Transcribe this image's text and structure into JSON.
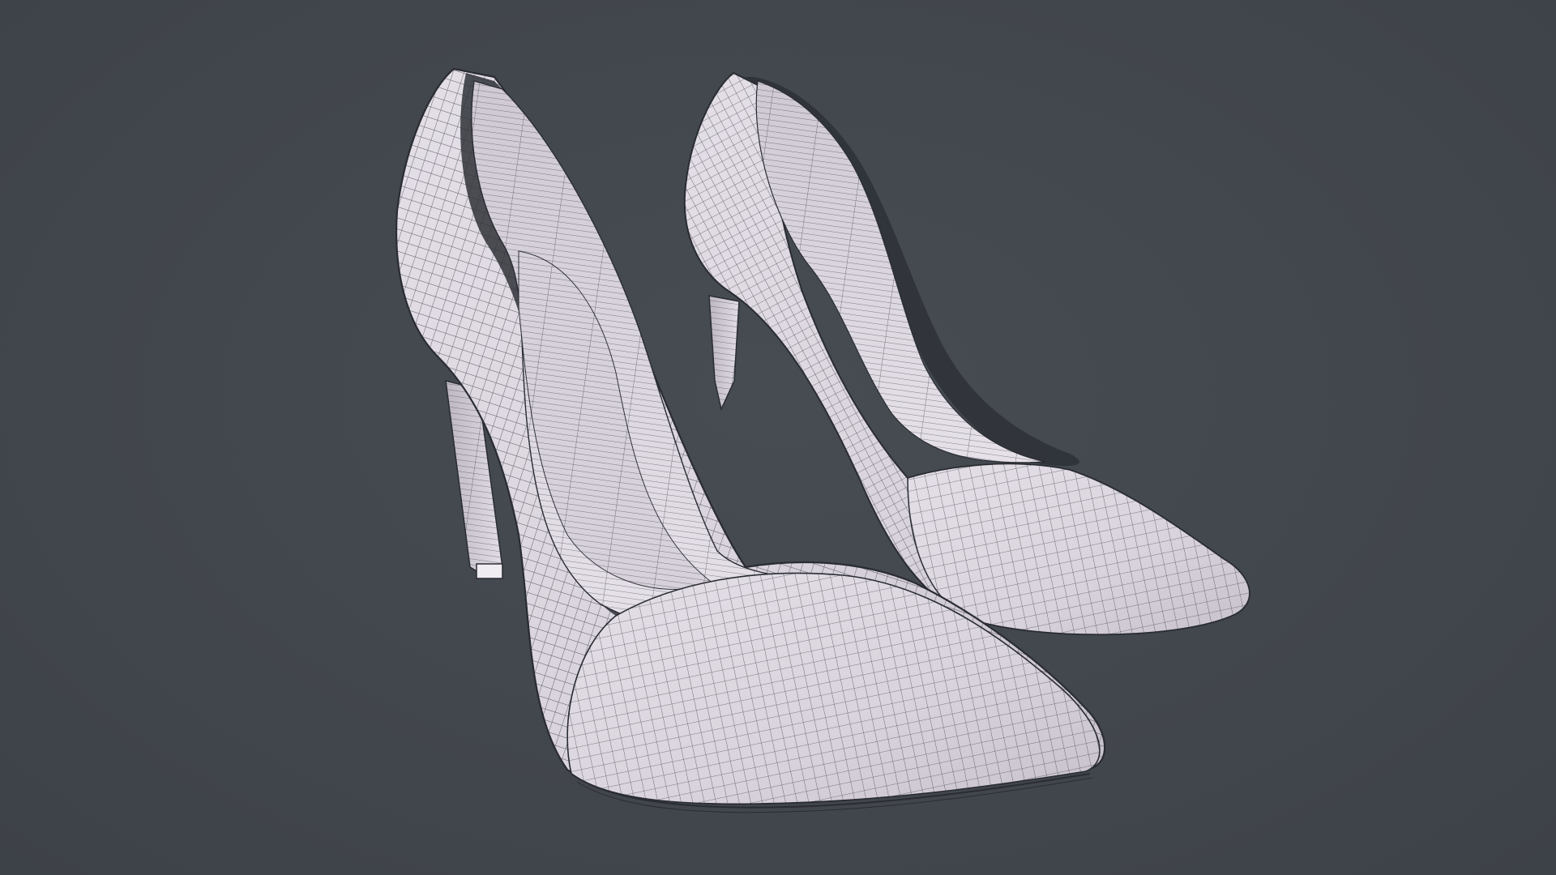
{
  "scene": {
    "background_color": "#42474d",
    "surface_color": "#ddd8e0",
    "wire_color": "#2a2c33",
    "objects": [
      {
        "name": "high-heel-pump-left",
        "shading": "wireframe-on-shaded"
      },
      {
        "name": "high-heel-pump-right",
        "shading": "wireframe-on-shaded"
      }
    ]
  }
}
